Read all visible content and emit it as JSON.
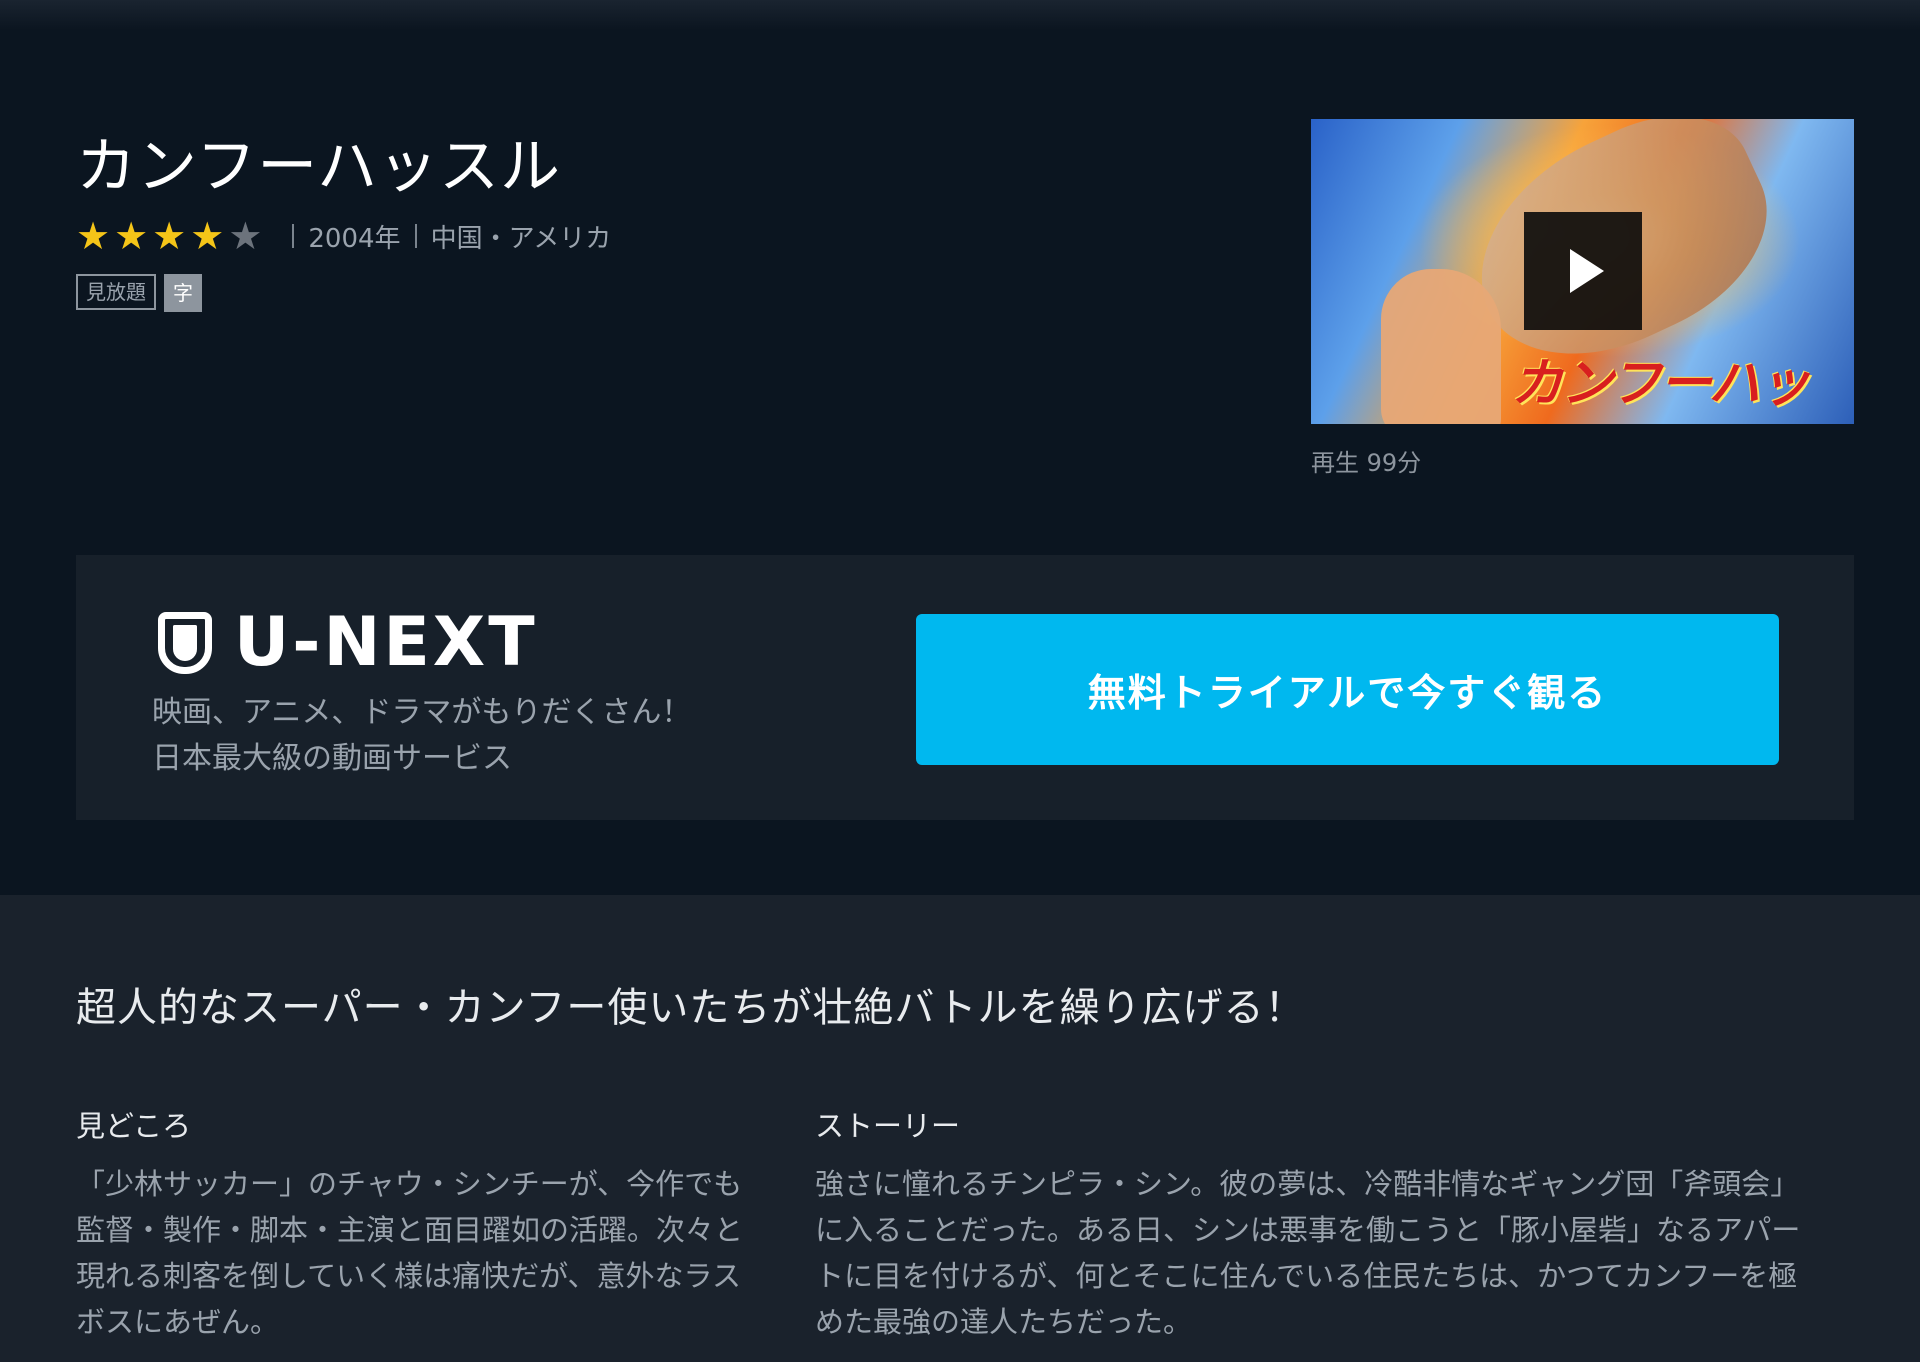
{
  "title": "カンフーハッスル",
  "rating": {
    "value": 4,
    "max": 5
  },
  "meta": {
    "year": "2004年",
    "country": "中国・アメリカ"
  },
  "badges": {
    "plan": "見放題",
    "subtitle": "字"
  },
  "thumbnail": {
    "logo_text": "カンフーハッスル",
    "play_icon": "play-icon"
  },
  "duration": "再生 99分",
  "promo": {
    "brand": "U-NEXT",
    "line1": "映画、アニメ、ドラマがもりだくさん！",
    "line2": "日本最大級の動画サービス",
    "cta": "無料トライアルで今すぐ観る"
  },
  "tagline": "超人的なスーパー・カンフー使いたちが壮絶バトルを繰り広げる！",
  "highlights": {
    "heading": "見どころ",
    "lines": [
      "「少林サッカー」のチャウ・シンチーが、今作でも",
      "監督・製作・脚本・主演と面目躍如の活躍。次々と",
      "現れる刺客を倒していく様は痛快だが、意外なラス",
      "ボスにあぜん。"
    ]
  },
  "story": {
    "heading": "ストーリー",
    "lines": [
      "強さに憧れるチンピラ・シン。彼の夢は、冷酷非情なギャング団「斧頭会」",
      "に入ることだった。ある日、シンは悪事を働こうと「豚小屋砦」なるアパー",
      "トに目を付けるが、何とそこに住んでいる住民たちは、かつてカンフーを極",
      "めた最強の達人たちだった。"
    ]
  },
  "colors": {
    "accent": "#00b8ef",
    "star": "#f5c518",
    "background": "#0b1520"
  }
}
